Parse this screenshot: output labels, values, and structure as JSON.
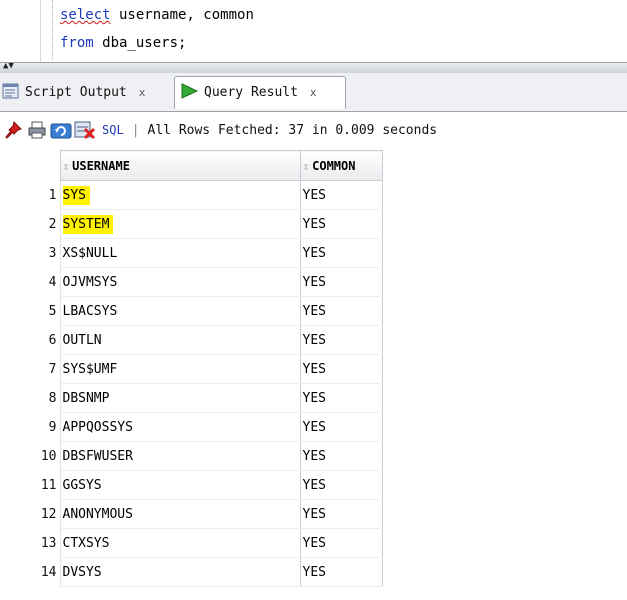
{
  "editor": {
    "line1": {
      "keyword": "select",
      "rest": " username, common"
    },
    "line2": {
      "keyword": "from",
      "rest": " dba_users;"
    }
  },
  "tabs": [
    {
      "label": "Script Output",
      "close": "x",
      "icon": "script-output-icon"
    },
    {
      "label": "Query Result",
      "close": "x",
      "icon": "run-arrow-icon"
    }
  ],
  "toolbar": {
    "sql_label": "SQL",
    "separator": "|",
    "status": "All Rows Fetched: 37 in 0.009 seconds"
  },
  "grid": {
    "columns": [
      "USERNAME",
      "COMMON"
    ],
    "rows": [
      {
        "n": "1",
        "username": "SYS",
        "common": "YES"
      },
      {
        "n": "2",
        "username": "SYSTEM",
        "common": "YES"
      },
      {
        "n": "3",
        "username": "XS$NULL",
        "common": "YES"
      },
      {
        "n": "4",
        "username": "OJVMSYS",
        "common": "YES"
      },
      {
        "n": "5",
        "username": "LBACSYS",
        "common": "YES"
      },
      {
        "n": "6",
        "username": "OUTLN",
        "common": "YES"
      },
      {
        "n": "7",
        "username": "SYS$UMF",
        "common": "YES"
      },
      {
        "n": "8",
        "username": "DBSNMP",
        "common": "YES"
      },
      {
        "n": "9",
        "username": "APPQOSSYS",
        "common": "YES"
      },
      {
        "n": "10",
        "username": "DBSFWUSER",
        "common": "YES"
      },
      {
        "n": "11",
        "username": "GGSYS",
        "common": "YES"
      },
      {
        "n": "12",
        "username": "ANONYMOUS",
        "common": "YES"
      },
      {
        "n": "13",
        "username": "CTXSYS",
        "common": "YES"
      },
      {
        "n": "14",
        "username": "DVSYS",
        "common": "YES"
      }
    ]
  },
  "colors": {
    "keyword": "#1f3ab8",
    "highlight": "#fff200",
    "run_green": "#2e9b2e"
  }
}
